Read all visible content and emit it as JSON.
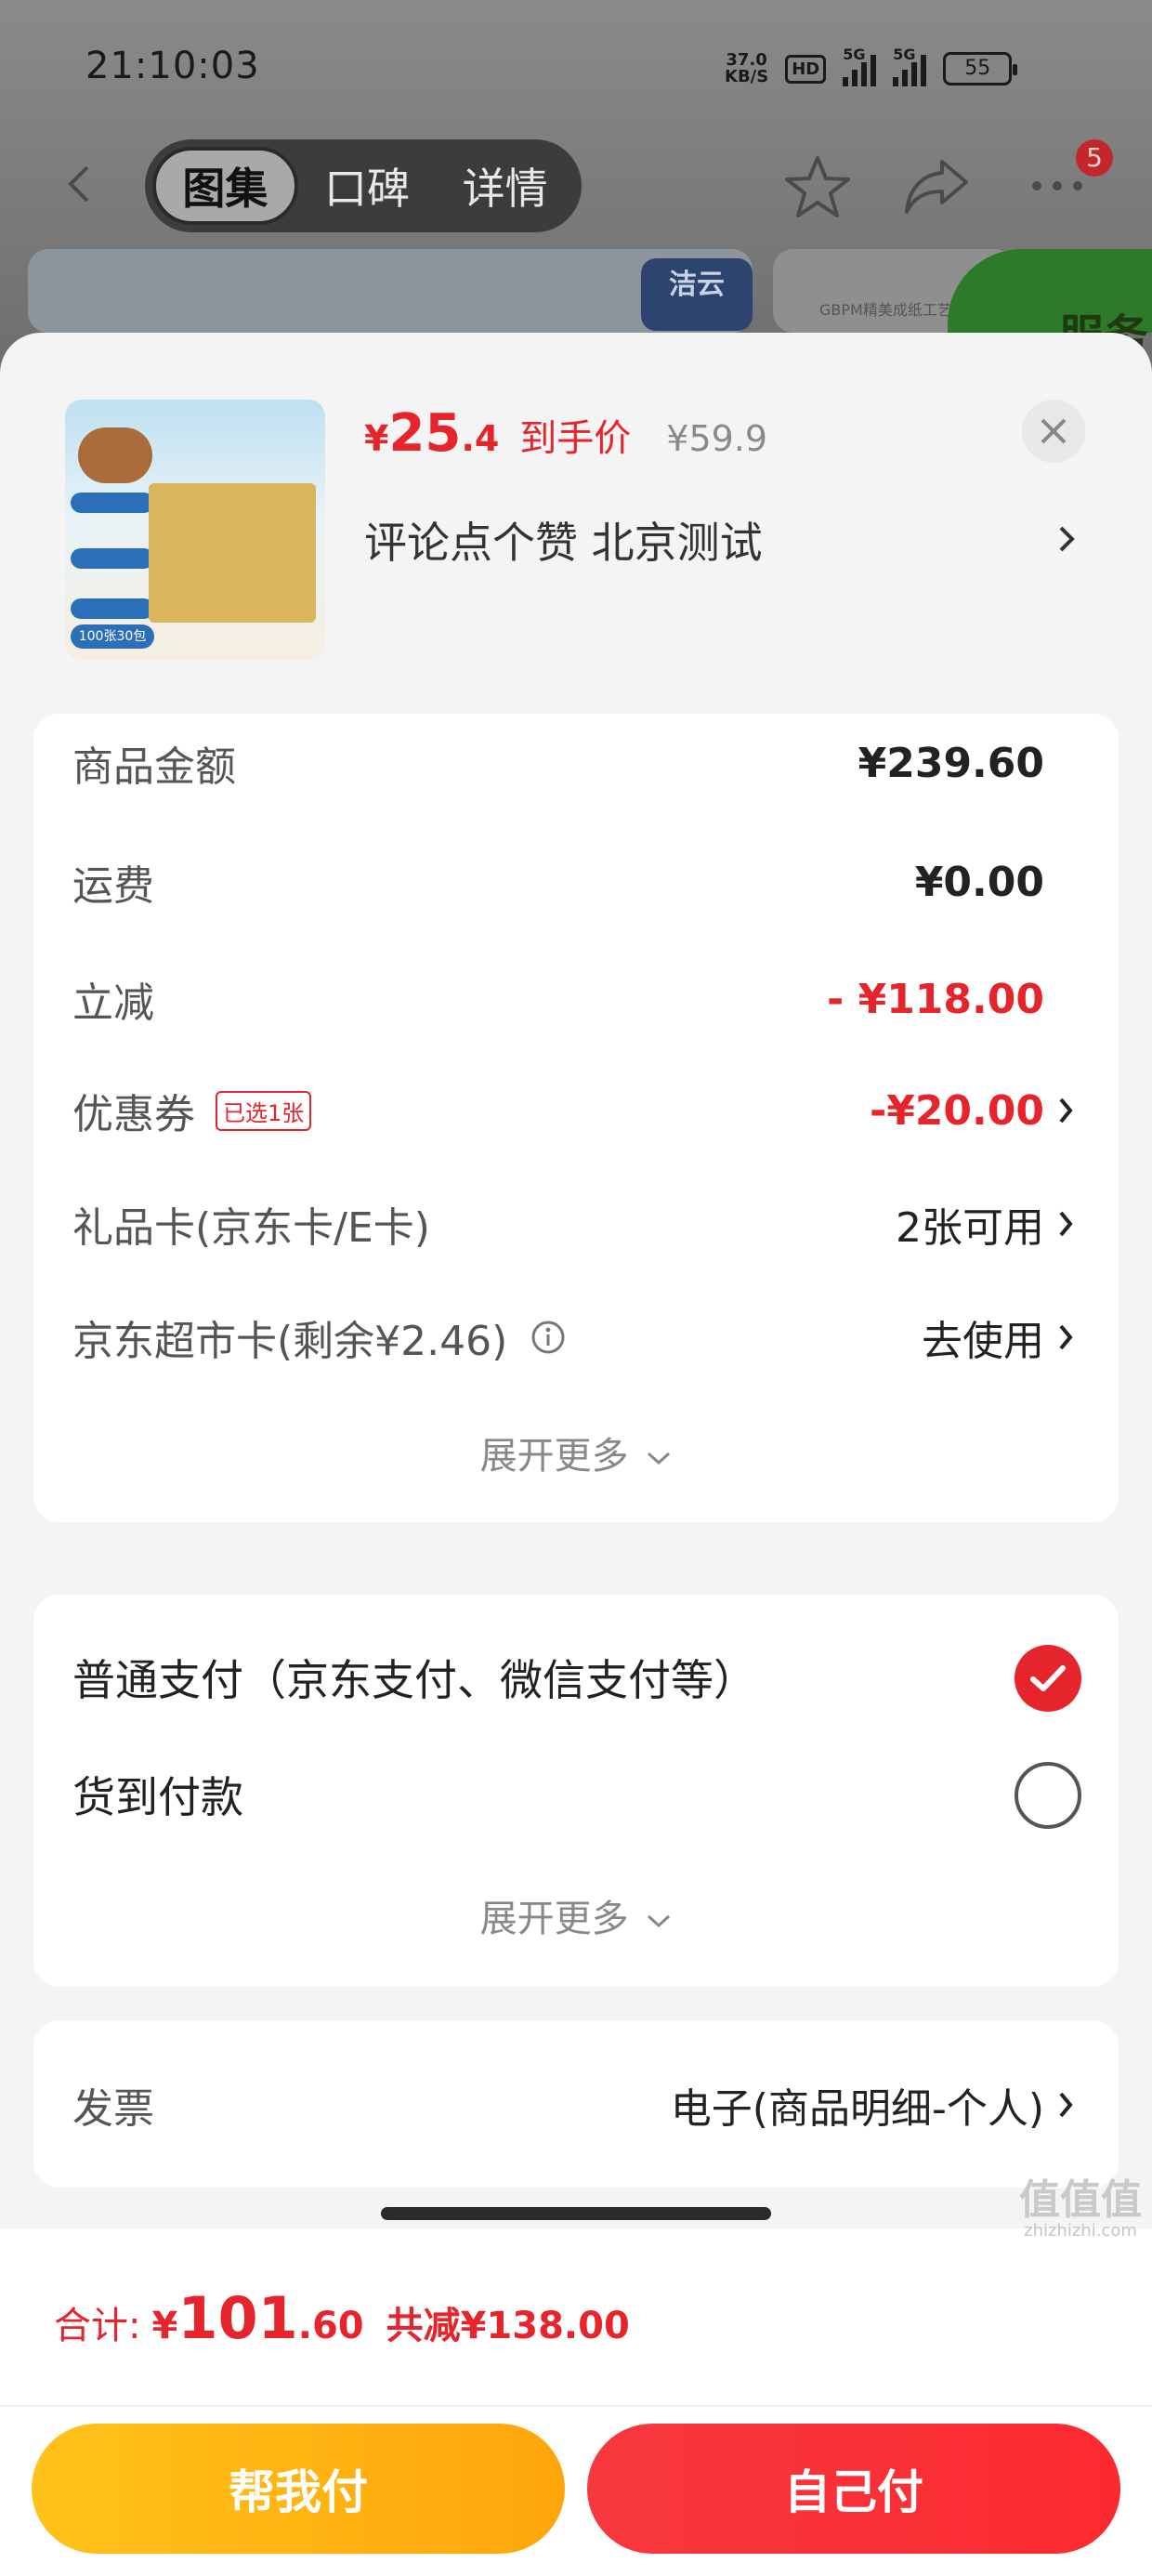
{
  "status_bar": {
    "time": "21:10:03",
    "net_speed_value": "37.0",
    "net_speed_unit": "KB/S",
    "hd_label": "HD",
    "sig1_label": "5G",
    "sig2_label": "5G",
    "battery": "55"
  },
  "nav": {
    "tabs": [
      {
        "label": "图集",
        "active": true
      },
      {
        "label": "口碑",
        "active": false
      },
      {
        "label": "详情",
        "active": false
      }
    ],
    "more_badge": "5"
  },
  "background": {
    "brand_text": "洁云",
    "card_snippet": "GBPM精美成纸工艺",
    "green_text": "服务"
  },
  "product": {
    "price_yen": "¥",
    "price_int": "25",
    "price_dec": ".4",
    "price_label": "到手价",
    "original_price": "¥59.9",
    "title": "评论点个赞  北京测试",
    "thumb_pack_text": "100张30包"
  },
  "fees": {
    "rows": [
      {
        "label": "商品金额",
        "value": "¥239.60"
      },
      {
        "label": "运费",
        "value": "¥0.00"
      },
      {
        "label": "立减",
        "value": "- ¥118.00"
      },
      {
        "label": "优惠券",
        "tag": "已选1张",
        "value": "-¥20.00"
      },
      {
        "label": "礼品卡(京东卡/E卡)",
        "value": "2张可用"
      },
      {
        "label": "京东超市卡(剩余¥2.46)",
        "value": "去使用"
      }
    ],
    "expand_label": "展开更多"
  },
  "payment": {
    "options": [
      {
        "label": "普通支付（京东支付、微信支付等）",
        "selected": true
      },
      {
        "label": "货到付款",
        "selected": false
      }
    ],
    "expand_label": "展开更多"
  },
  "invoice": {
    "label": "发票",
    "value": "电子(商品明细-个人)"
  },
  "footer": {
    "total_label": "合计:",
    "total_yen": "¥",
    "total_int": "101",
    "total_dec": ".60",
    "saved": "共减¥138.00",
    "help_pay": "帮我付",
    "self_pay": "自己付"
  },
  "watermark": {
    "text": "值值值",
    "site": "zhizhizhi.com"
  },
  "colors": {
    "accent_red": "#e6242b",
    "button_yellow": "#ffb312",
    "button_red": "#f7383f"
  }
}
